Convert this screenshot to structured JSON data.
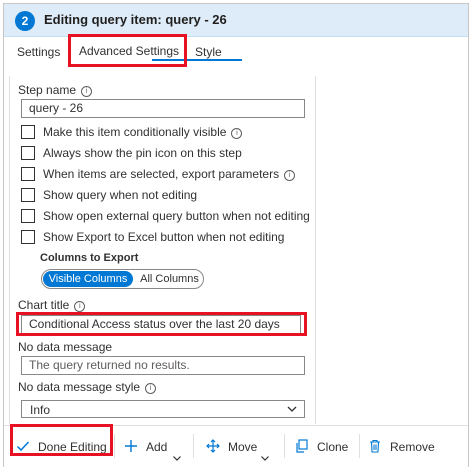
{
  "step": {
    "number": "2",
    "title": "Editing query item: query - 26"
  },
  "tabs": [
    {
      "label": "Settings"
    },
    {
      "label": "Advanced Settings"
    },
    {
      "label": "Style"
    }
  ],
  "fields": {
    "step_name": {
      "label": "Step name",
      "value": "query - 26"
    },
    "checkboxes": [
      {
        "label": "Make this item conditionally visible",
        "info": true,
        "checked": false
      },
      {
        "label": "Always show the pin icon on this step",
        "info": false,
        "checked": false
      },
      {
        "label": "When items are selected, export parameters",
        "info": true,
        "checked": false
      },
      {
        "label": "Show query when not editing",
        "info": false,
        "checked": false
      },
      {
        "label": "Show open external query button when not editing",
        "info": false,
        "checked": false
      },
      {
        "label": "Show Export to Excel button when not editing",
        "info": false,
        "checked": false
      }
    ],
    "columns_to_export": {
      "label": "Columns to Export",
      "options": [
        "Visible Columns",
        "All Columns"
      ],
      "selected": "Visible Columns"
    },
    "chart_title": {
      "label": "Chart title",
      "value": "Conditional Access status over the last 20 days"
    },
    "no_data_message": {
      "label": "No data message",
      "placeholder": "The query returned no results."
    },
    "no_data_message_style": {
      "label": "No data message style",
      "value": "Info"
    }
  },
  "toolbar": {
    "done_editing": "Done Editing",
    "add": "Add",
    "move": "Move",
    "clone": "Clone",
    "remove": "Remove"
  },
  "colors": {
    "accent": "#0078d4",
    "highlight_box": "#e81123",
    "header_bg": "#deecf9"
  },
  "icons": [
    "info-icon",
    "chevron-down-icon",
    "checkmark-icon",
    "plus-icon",
    "move-icon",
    "clone-icon",
    "trash-icon"
  ]
}
